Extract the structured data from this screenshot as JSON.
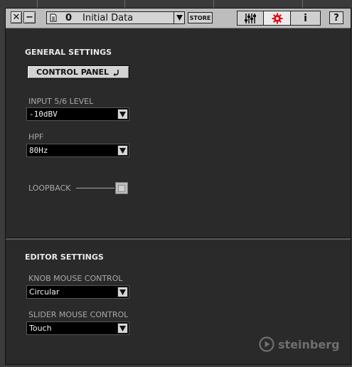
{
  "toolbar": {
    "close_glyph": "✕",
    "minimize_glyph": "−",
    "preset_number": "0",
    "preset_name": "Initial Data",
    "store_label": "STORE",
    "help_label": "?",
    "tabs": [
      {
        "icon": "mixer-icon",
        "active": false
      },
      {
        "icon": "gear-icon",
        "active": true,
        "color": "#e0101a"
      },
      {
        "icon": "info-icon",
        "active": false
      }
    ],
    "info_glyph": "i"
  },
  "general": {
    "title": "GENERAL SETTINGS",
    "control_panel_label": "CONTROL PANEL",
    "input_level_label": "INPUT 5/6 LEVEL",
    "input_level_value": "-10dBV",
    "hpf_label": "HPF",
    "hpf_value": "80Hz",
    "loopback_label": "LOOPBACK",
    "loopback_checked": false
  },
  "editor": {
    "title": "EDITOR SETTINGS",
    "knob_label": "KNOB MOUSE CONTROL",
    "knob_value": "Circular",
    "slider_label": "SLIDER MOUSE CONTROL",
    "slider_value": "Touch"
  },
  "brand": {
    "logo_text": "steinberg"
  },
  "colors": {
    "accent_red": "#e0101a",
    "panel_bg": "#2a2a2a",
    "toolbar_bg": "#bdbdbd"
  }
}
